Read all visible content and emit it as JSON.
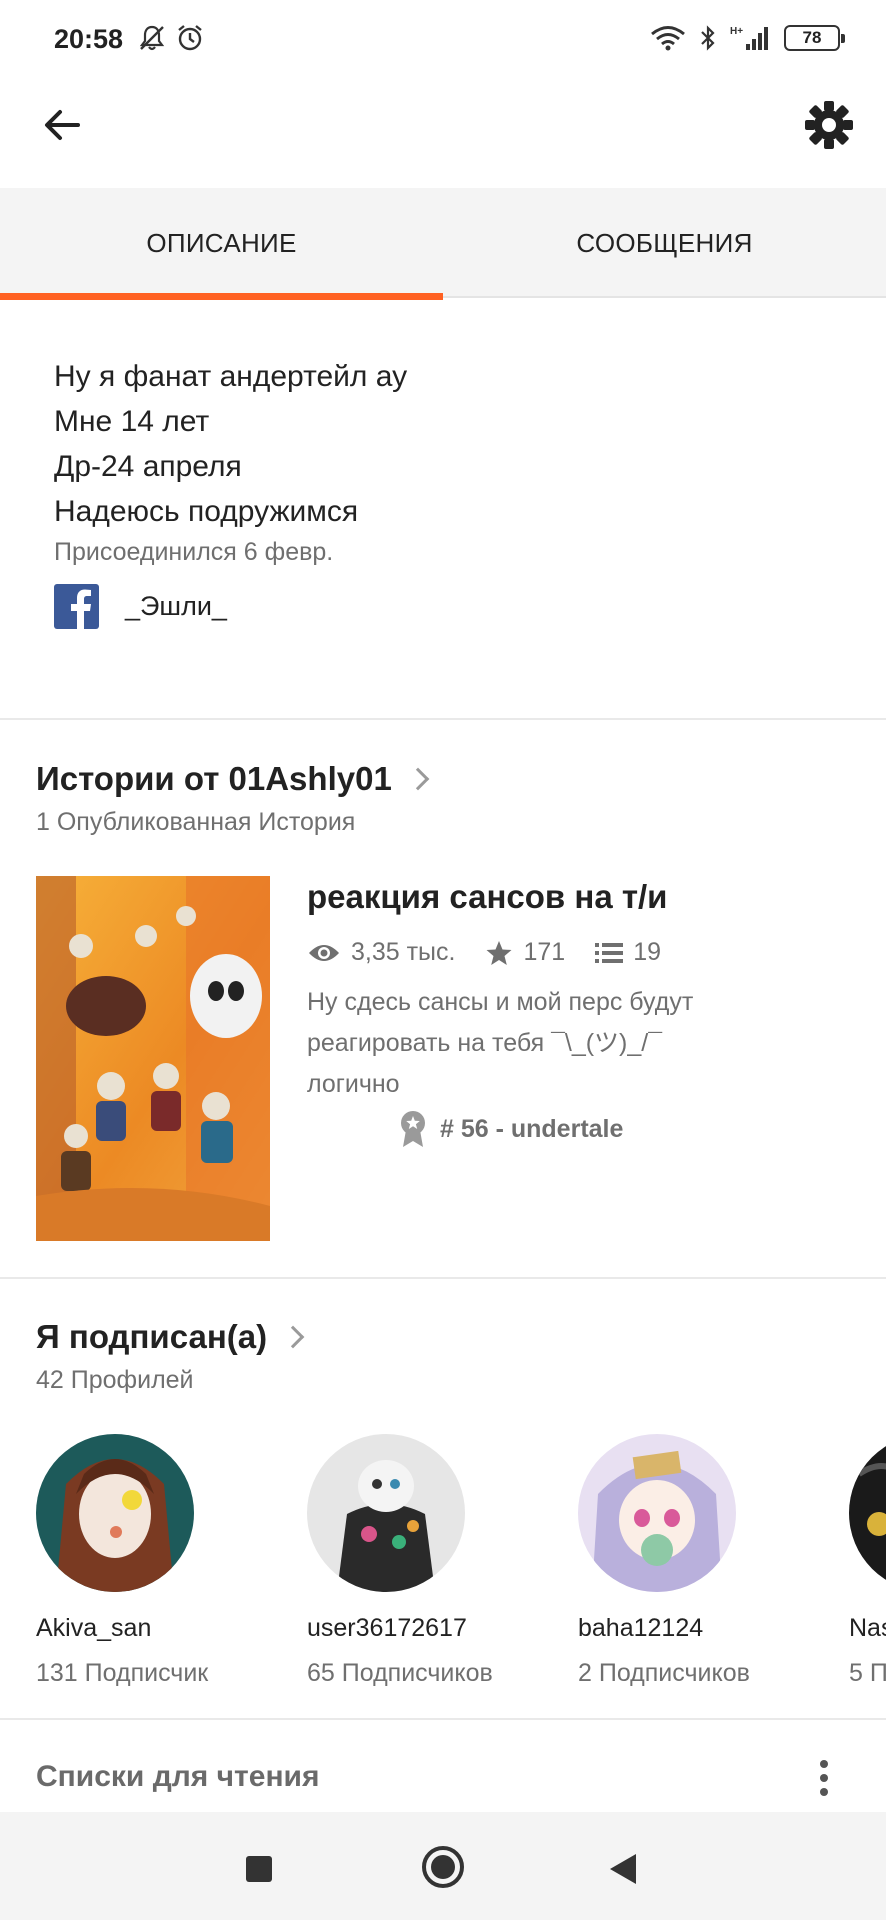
{
  "status_bar": {
    "time": "20:58",
    "battery": "78",
    "network_label": "H+"
  },
  "tabs": [
    {
      "label": "ОПИСАНИЕ",
      "active": true
    },
    {
      "label": "СООБЩЕНИЯ",
      "active": false
    }
  ],
  "accent_color": "#ff6122",
  "description": {
    "lines": [
      "Ну я фанат андертейл ау",
      "Мне 14 лет",
      "Др-24 апреля",
      "Надеюсь подружимся"
    ],
    "joined": "Присоединился 6 февр.",
    "facebook_name": "_Эшли_"
  },
  "stories": {
    "title": "Истории от 01Ashly01",
    "count_label": "1 Опубликованная История",
    "items": [
      {
        "title": "реакция сансов на т/и",
        "views": "3,35 тыс.",
        "votes": "171",
        "parts": "19",
        "description": "Ну сдесь сансы и мой перс будут реагировать на тебя ¯\\_(ツ)_/¯ логично",
        "rank": "# 56 - undertale"
      }
    ]
  },
  "following": {
    "title": "Я подписан(а)",
    "count_label": "42 Профилей",
    "profiles": [
      {
        "name": "Akiva_san",
        "followers": "131 Подписчик"
      },
      {
        "name": "user36172617",
        "followers": "65 Подписчиков"
      },
      {
        "name": "baha12124",
        "followers": "2 Подписчиков"
      },
      {
        "name": "Nas",
        "followers": "5 П"
      }
    ]
  },
  "reading_lists": {
    "title": "Списки для чтения"
  }
}
